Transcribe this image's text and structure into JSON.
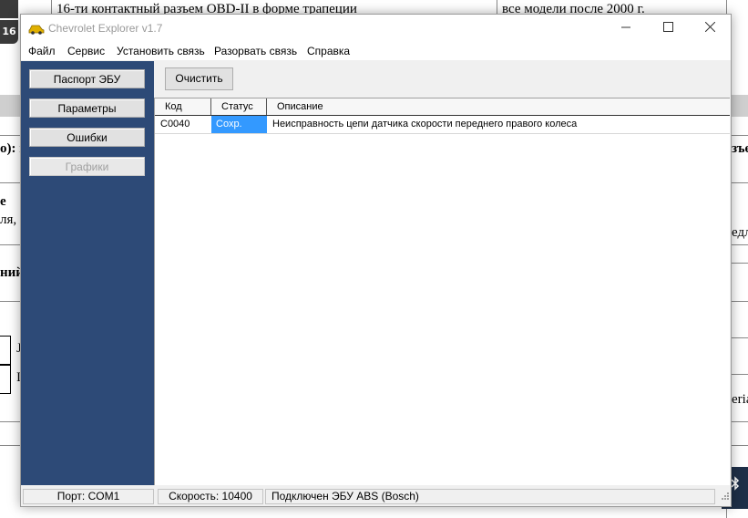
{
  "background": {
    "top_text_left": "16-ти контактный разъем OBD-II в форме трапеции",
    "top_text_right": "все модели после 2000 г.",
    "icon_label": "16",
    "frag_left_1": "о): в",
    "frag_left_2": "е",
    "frag_left_3": "ля,",
    "frag_left_4": "ний",
    "frag_left_5": "J",
    "frag_left_6": "I",
    "frag_right_1": "зъе",
    "frag_right_2": "едло",
    "frag_right_3": "eria"
  },
  "window": {
    "title": "Chevrolet Explorer v1.7",
    "menu": [
      "Файл",
      "Сервис",
      "Установить связь",
      "Разорвать связь",
      "Справка"
    ],
    "left_buttons": [
      {
        "label": "Паспорт ЭБУ",
        "enabled": true
      },
      {
        "label": "Параметры",
        "enabled": true
      },
      {
        "label": "Ошибки",
        "enabled": true
      },
      {
        "label": "Графики",
        "enabled": false
      }
    ],
    "toolbar": {
      "clear_label": "Очистить"
    },
    "table": {
      "columns": [
        "Код",
        "Статус",
        "Описание"
      ],
      "rows": [
        {
          "code": "C0040",
          "status": "Сохр.",
          "description": "Неисправность цепи датчика скорости переднего правого колеса"
        }
      ]
    },
    "status": {
      "port": "Порт: COM1",
      "speed": "Скорость: 10400",
      "connection": "Подключен ЭБУ ABS (Bosch)"
    }
  },
  "colors": {
    "panel_blue": "#2d4a77",
    "selection_blue": "#3399ff"
  },
  "icons": [
    "car-icon",
    "minimize-icon",
    "maximize-icon",
    "close-icon",
    "bluetooth-icon",
    "resize-grip-icon"
  ]
}
